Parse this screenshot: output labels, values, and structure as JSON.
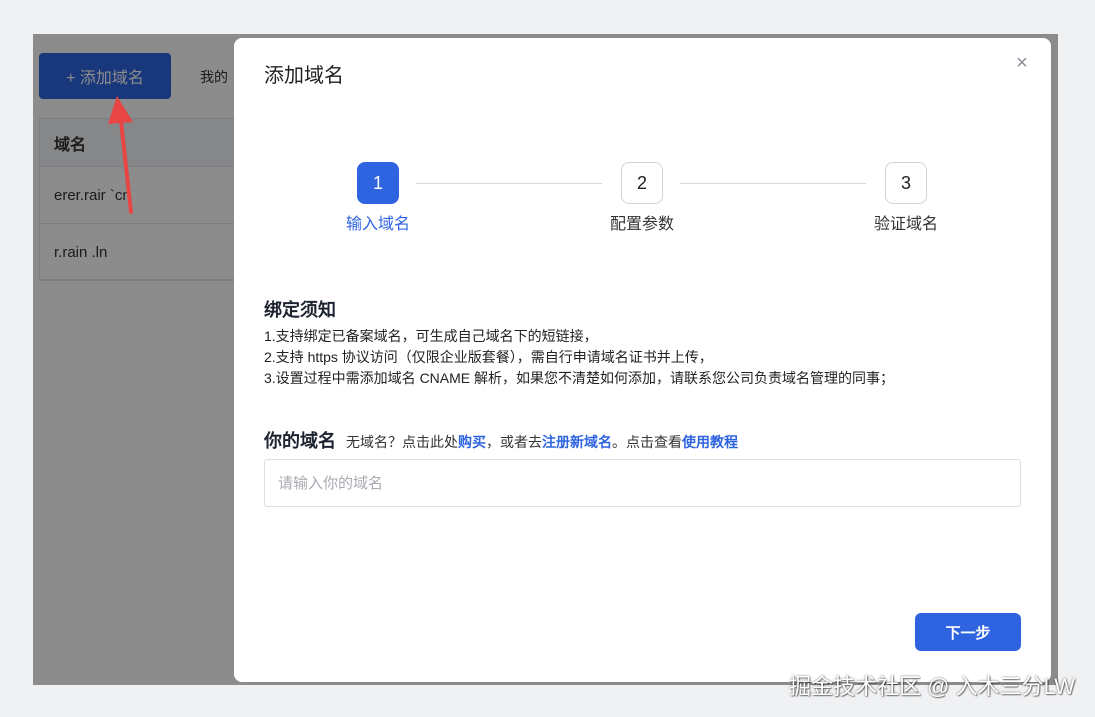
{
  "background": {
    "add_button_label": "+ 添加域名",
    "tab_partial": "我的",
    "table_header": "域名",
    "rows": [
      "erer.rair `cn",
      "r.rain .ln"
    ]
  },
  "modal": {
    "title": "添加域名",
    "close_glyph": "×",
    "steps": [
      {
        "number": "1",
        "label": "输入域名",
        "state": "active"
      },
      {
        "number": "2",
        "label": "配置参数",
        "state": "idle"
      },
      {
        "number": "3",
        "label": "验证域名",
        "state": "idle"
      }
    ],
    "notice": {
      "title": "绑定须知",
      "items": [
        "1.支持绑定已备案域名，可生成自己域名下的短链接，",
        "2.支持 https 协议访问（仅限企业版套餐），需自行申请域名证书并上传，",
        "3.设置过程中需添加域名 CNAME 解析，如果您不清楚如何添加，请联系您公司负责域名管理的同事；"
      ]
    },
    "domain": {
      "label": "你的域名",
      "hint_prefix": "无域名？点击此处",
      "link_buy": "购买",
      "hint_mid": "，或者去",
      "link_register": "注册新域名",
      "hint_mid2": "。点击查看",
      "link_tutorial": "使用教程",
      "placeholder": "请输入你的域名",
      "value": ""
    },
    "next_label": "下一步"
  },
  "watermark": "掘金技术社区 @ 入木三分LW",
  "colors": {
    "primary": "#2f64e0",
    "arrow": "#e84545"
  }
}
